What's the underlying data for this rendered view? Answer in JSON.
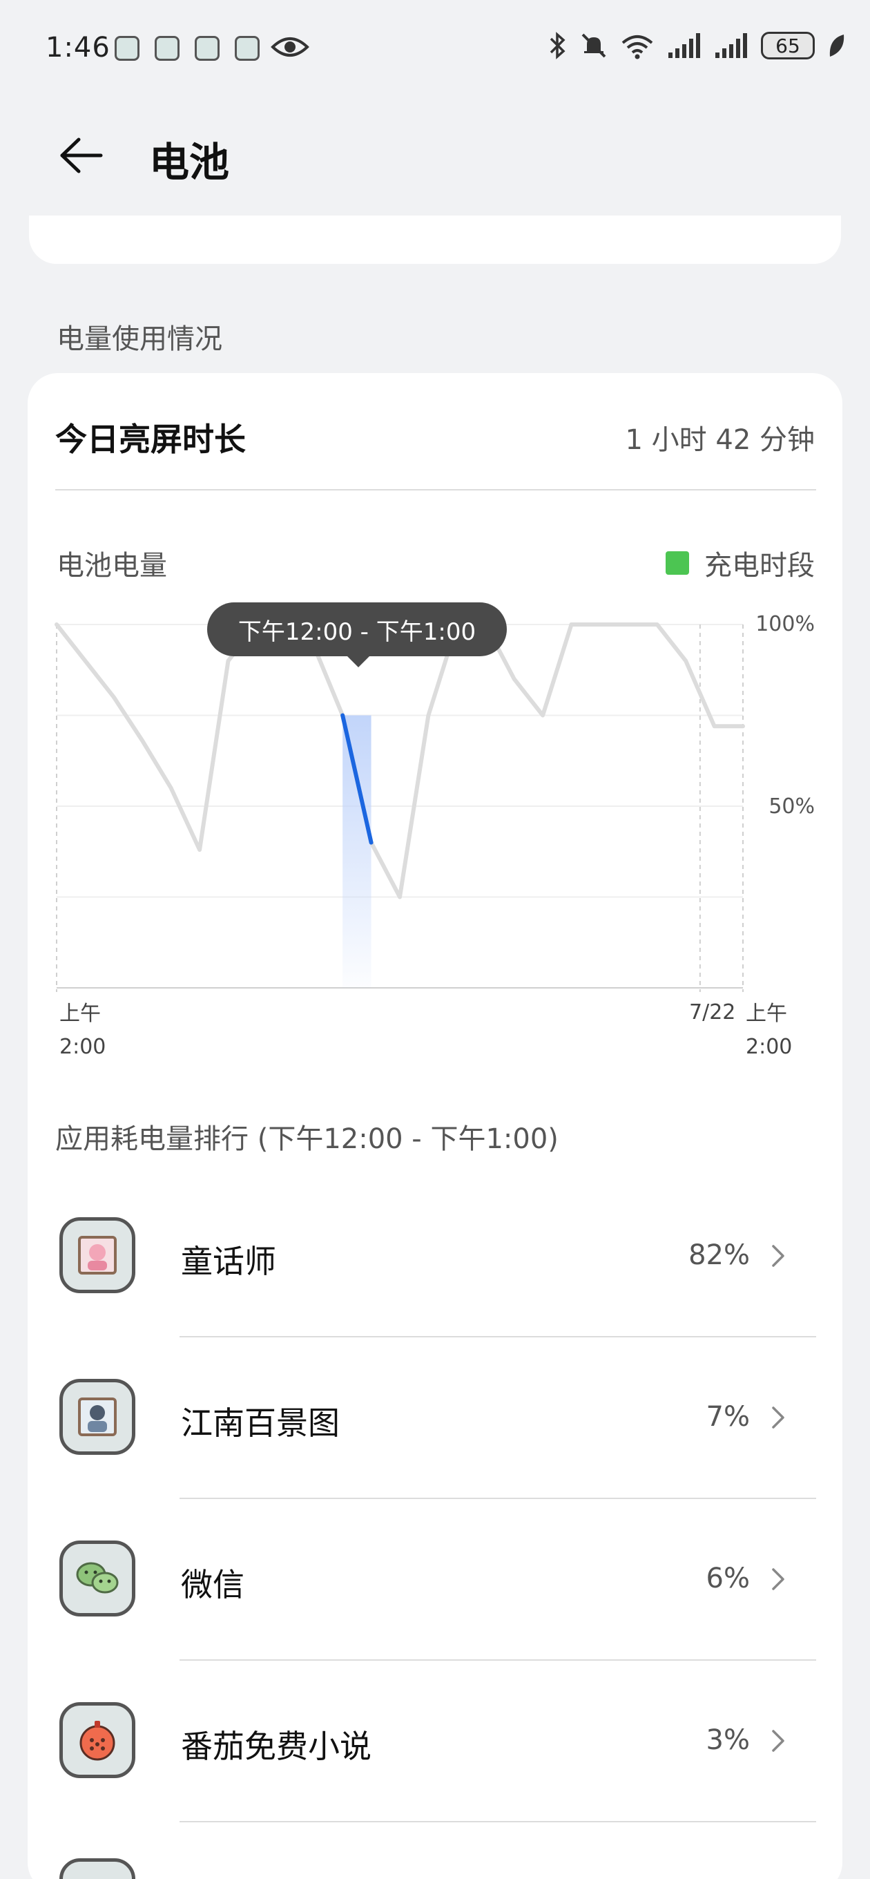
{
  "status_bar": {
    "time": "1:46",
    "battery": "65",
    "icons": [
      "notification-app-icon",
      "notification-app-icon",
      "notification-app-icon",
      "notification-app-icon",
      "eye-icon",
      "bluetooth-icon",
      "mute-bell-icon",
      "wifi-icon",
      "signal-icon",
      "signal-icon",
      "battery-icon",
      "leaf-icon"
    ]
  },
  "header": {
    "title": "电池",
    "back_icon": "back-arrow-icon"
  },
  "usage": {
    "section_label": "电量使用情况",
    "screen_time_label": "今日亮屏时长",
    "screen_time_value": "1 小时 42 分钟"
  },
  "chart": {
    "label": "电池电量",
    "legend_label": "充电时段",
    "tooltip": "下午12:00 - 下午1:00",
    "y_top": "100%",
    "y_mid": "50%",
    "x_start_top": "上午",
    "x_start_bottom": "2:00",
    "x_date": "7/22",
    "x_end_top": "上午",
    "x_end_bottom": "2:00"
  },
  "chart_data": {
    "type": "line",
    "title": "",
    "xlabel": "",
    "ylabel": "",
    "ylim": [
      0,
      100
    ],
    "x": [
      0,
      1,
      2,
      3,
      4,
      5,
      6,
      7,
      8,
      9,
      10,
      11,
      12,
      13,
      14,
      15,
      16,
      17,
      18,
      19,
      20,
      21,
      22,
      23,
      24
    ],
    "series": [
      {
        "values": [
          100,
          90,
          80,
          68,
          55,
          38,
          90,
          100,
          100,
          94,
          75,
          40,
          25,
          75,
          100,
          100,
          85,
          75,
          100,
          100,
          100,
          100,
          90,
          72,
          72
        ]
      }
    ],
    "highlight_range": [
      10,
      11
    ],
    "grid": true,
    "legend": "top-right",
    "colors": {
      "line": "#dcdcdc",
      "highlight_line": "#1b66e0",
      "highlight_fill": "#c9d9fb",
      "charging": "#4cc552"
    }
  },
  "ranking": {
    "title": "应用耗电量排行 (下午12:00 - 下午1:00)",
    "apps": [
      {
        "name": "童话师",
        "percent": "82%"
      },
      {
        "name": "江南百景图",
        "percent": "7%"
      },
      {
        "name": "微信",
        "percent": "6%"
      },
      {
        "name": "番茄免费小说",
        "percent": "3%"
      }
    ]
  }
}
